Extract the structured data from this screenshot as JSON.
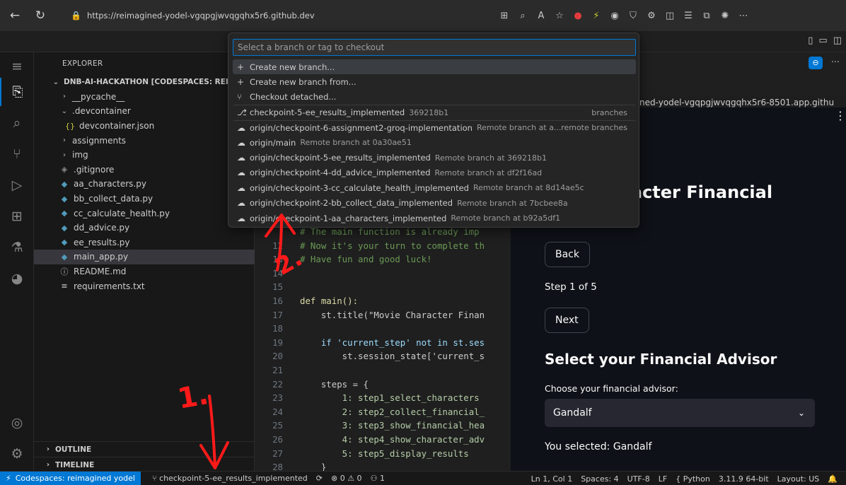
{
  "browser": {
    "url": "https://reimagined-yodel-vgqpgjwvqgqhx5r6.github.dev"
  },
  "explorer": {
    "title": "EXPLORER",
    "root": "DNB-AI-HACKATHON [CODESPACES: REIMAGI",
    "items": [
      {
        "label": "__pycache__",
        "type": "folder",
        "indent": 1,
        "open": false
      },
      {
        "label": ".devcontainer",
        "type": "folder",
        "indent": 1,
        "open": true
      },
      {
        "label": "devcontainer.json",
        "type": "json",
        "indent": 2
      },
      {
        "label": "assignments",
        "type": "folder",
        "indent": 1,
        "open": false
      },
      {
        "label": "img",
        "type": "folder",
        "indent": 1,
        "open": false
      },
      {
        "label": ".gitignore",
        "type": "git",
        "indent": 1
      },
      {
        "label": "aa_characters.py",
        "type": "py",
        "indent": 1
      },
      {
        "label": "bb_collect_data.py",
        "type": "py",
        "indent": 1
      },
      {
        "label": "cc_calculate_health.py",
        "type": "py",
        "indent": 1
      },
      {
        "label": "dd_advice.py",
        "type": "py",
        "indent": 1
      },
      {
        "label": "ee_results.py",
        "type": "py",
        "indent": 1
      },
      {
        "label": "main_app.py",
        "type": "py",
        "indent": 1,
        "selected": true
      },
      {
        "label": "README.md",
        "type": "info",
        "indent": 1
      },
      {
        "label": "requirements.txt",
        "type": "txt",
        "indent": 1
      }
    ],
    "outline": "OUTLINE",
    "timeline": "TIMELINE"
  },
  "quickpick": {
    "placeholder": "Select a branch or tag to checkout",
    "items": [
      {
        "icon": "+",
        "label": "Create new branch...",
        "desc": "",
        "group": ""
      },
      {
        "icon": "+",
        "label": "Create new branch from...",
        "desc": "",
        "group": ""
      },
      {
        "icon": "⑂",
        "label": "Checkout detached...",
        "desc": "",
        "group": ""
      },
      {
        "icon": "⎇",
        "label": "checkpoint-5-ee_results_implemented",
        "desc": "369218b1",
        "group": "branches"
      },
      {
        "icon": "☁",
        "label": "origin/checkpoint-6-assignment2-groq-implementation",
        "desc": "Remote branch at a...",
        "group": "remote branches"
      },
      {
        "icon": "☁",
        "label": "origin/main",
        "desc": "Remote branch at 0a30ae51",
        "group": ""
      },
      {
        "icon": "☁",
        "label": "origin/checkpoint-5-ee_results_implemented",
        "desc": "Remote branch at 369218b1",
        "group": ""
      },
      {
        "icon": "☁",
        "label": "origin/checkpoint-4-dd_advice_implemented",
        "desc": "Remote branch at df2f16ad",
        "group": ""
      },
      {
        "icon": "☁",
        "label": "origin/checkpoint-3-cc_calculate_health_implemented",
        "desc": "Remote branch at 8d14ae5c",
        "group": ""
      },
      {
        "icon": "☁",
        "label": "origin/checkpoint-2-bb_collect_data_implemented",
        "desc": "Remote branch at 7bcbee8a",
        "group": ""
      },
      {
        "icon": "☁",
        "label": "origin/checkpoint-1-aa_characters_implemented",
        "desc": "Remote branch at b92a5df1",
        "group": ""
      }
    ]
  },
  "editor": {
    "lines": [
      {
        "n": "",
        "t": "# The main function is already imp"
      },
      {
        "n": "12",
        "t": "# Now it's your turn to complete th"
      },
      {
        "n": "13",
        "t": "# Have fun and good luck!"
      },
      {
        "n": "14",
        "t": ""
      },
      {
        "n": "15",
        "t": ""
      },
      {
        "n": "16",
        "t": "def main():"
      },
      {
        "n": "17",
        "t": "    st.title(\"Movie Character Finan"
      },
      {
        "n": "18",
        "t": ""
      },
      {
        "n": "19",
        "t": "    if 'current_step' not in st.ses"
      },
      {
        "n": "20",
        "t": "        st.session_state['current_s"
      },
      {
        "n": "21",
        "t": ""
      },
      {
        "n": "22",
        "t": "    steps = {"
      },
      {
        "n": "23",
        "t": "        1: step1_select_characters"
      },
      {
        "n": "24",
        "t": "        2: step2_collect_financial_"
      },
      {
        "n": "25",
        "t": "        3: step3_show_financial_hea"
      },
      {
        "n": "26",
        "t": "        4: step4_show_character_adv"
      },
      {
        "n": "27",
        "t": "        5: step5_display_results"
      },
      {
        "n": "28",
        "t": "    }"
      },
      {
        "n": "29",
        "t": ""
      }
    ]
  },
  "preview": {
    "url": "ned-yodel-vgqpgjwvqgqhx5r6-8501.app.githu",
    "heading": "racter Financial",
    "back": "Back",
    "step": "Step 1 of 5",
    "next": "Next",
    "advisor_heading": "Select your Financial Advisor",
    "choose_label": "Choose your financial advisor:",
    "selected_value": "Gandalf",
    "you_selected": "You selected: Gandalf"
  },
  "status": {
    "remote": "Codespaces: reimagined yodel",
    "branch": "checkpoint-5-ee_results_implemented",
    "problems": "⊗ 0 ⚠ 0",
    "ports": "1",
    "position": "Ln 1, Col 1",
    "spaces": "Spaces: 4",
    "encoding": "UTF-8",
    "eol": "LF",
    "language": "Python",
    "interpreter": "3.11.9 64-bit",
    "layout": "Layout: US"
  },
  "annotations": {
    "label1": "1.",
    "label2": "2."
  },
  "colors": {
    "accent": "#0078d4",
    "annotation": "#ff1a1a"
  }
}
